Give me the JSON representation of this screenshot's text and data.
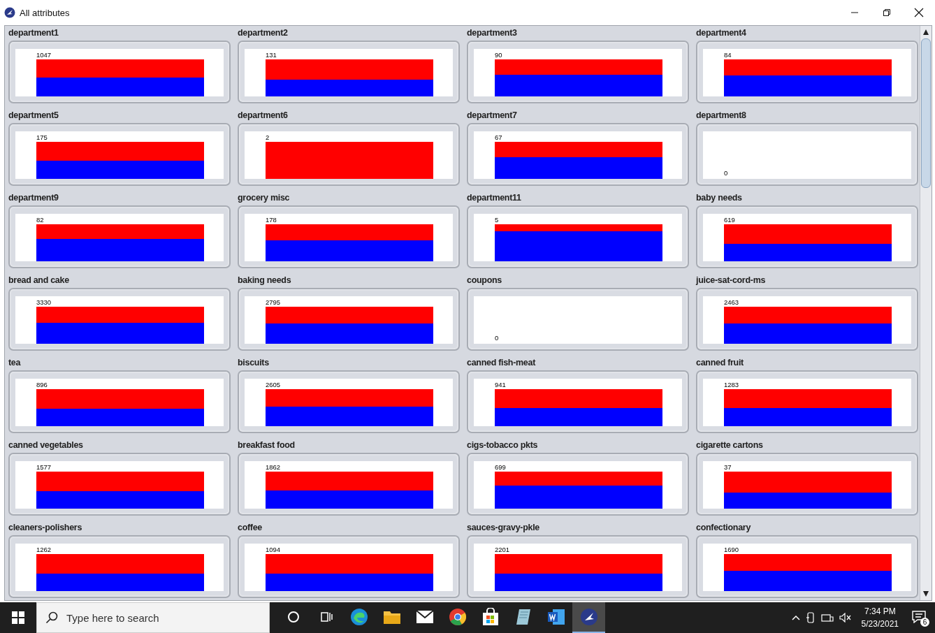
{
  "window": {
    "title": "All attributes"
  },
  "attributes": [
    {
      "name": "department1",
      "count": "1047",
      "kind": "bar"
    },
    {
      "name": "department2",
      "count": "131",
      "kind": "bar"
    },
    {
      "name": "department3",
      "count": "90",
      "kind": "bar"
    },
    {
      "name": "department4",
      "count": "84",
      "kind": "bar"
    },
    {
      "name": "department5",
      "count": "175",
      "kind": "bar"
    },
    {
      "name": "department6",
      "count": "2",
      "kind": "bar"
    },
    {
      "name": "department7",
      "count": "67",
      "kind": "bar"
    },
    {
      "name": "department8",
      "count": "0",
      "kind": "empty"
    },
    {
      "name": "department9",
      "count": "82",
      "kind": "bar"
    },
    {
      "name": "grocery misc",
      "count": "178",
      "kind": "bar"
    },
    {
      "name": "department11",
      "count": "5",
      "kind": "bar"
    },
    {
      "name": "baby needs",
      "count": "619",
      "kind": "bar"
    },
    {
      "name": "bread and cake",
      "count": "3330",
      "kind": "bar"
    },
    {
      "name": "baking needs",
      "count": "2795",
      "kind": "bar"
    },
    {
      "name": "coupons",
      "count": "0",
      "kind": "empty"
    },
    {
      "name": "juice-sat-cord-ms",
      "count": "2463",
      "kind": "bar"
    },
    {
      "name": "tea",
      "count": "896",
      "kind": "bar"
    },
    {
      "name": "biscuits",
      "count": "2605",
      "kind": "bar"
    },
    {
      "name": "canned fish-meat",
      "count": "941",
      "kind": "bar"
    },
    {
      "name": "canned fruit",
      "count": "1283",
      "kind": "bar"
    },
    {
      "name": "canned vegetables",
      "count": "1577",
      "kind": "bar"
    },
    {
      "name": "breakfast food",
      "count": "1862",
      "kind": "bar"
    },
    {
      "name": "cigs-tobacco pkts",
      "count": "699",
      "kind": "bar"
    },
    {
      "name": "cigarette cartons",
      "count": "37",
      "kind": "bar"
    },
    {
      "name": "cleaners-polishers",
      "count": "1262",
      "kind": "bar"
    },
    {
      "name": "coffee",
      "count": "1094",
      "kind": "bar"
    },
    {
      "name": "sauces-gravy-pkle",
      "count": "2201",
      "kind": "bar"
    },
    {
      "name": "confectionary",
      "count": "1690",
      "kind": "bar"
    }
  ],
  "taskbar": {
    "search": {
      "placeholder": "Type here to search"
    },
    "apps": [
      {
        "kind": "cortana",
        "selected": false
      },
      {
        "kind": "taskview",
        "selected": false
      },
      {
        "kind": "edge",
        "selected": false
      },
      {
        "kind": "explorer",
        "selected": false
      },
      {
        "kind": "mail",
        "selected": false
      },
      {
        "kind": "chrome",
        "selected": false
      },
      {
        "kind": "store",
        "selected": false
      },
      {
        "kind": "notes",
        "selected": false
      },
      {
        "kind": "word",
        "selected": false
      },
      {
        "kind": "weka",
        "selected": true
      }
    ],
    "time": "7:34 PM",
    "date": "5/23/2021",
    "notifications": "6"
  }
}
